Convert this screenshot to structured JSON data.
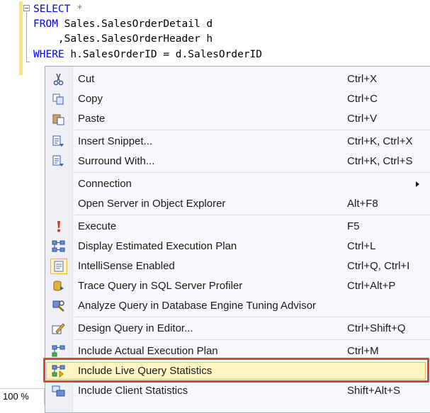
{
  "editor": {
    "lines": [
      {
        "kw": "SELECT",
        "rest": " *"
      },
      {
        "kw": "FROM",
        "rest": " Sales.SalesOrderDetail d"
      },
      {
        "kw": "",
        "rest": "    ,Sales.SalesOrderHeader h"
      },
      {
        "kw": "WHERE",
        "rest": " h.SalesOrderID = d.SalesOrderID"
      }
    ]
  },
  "status": {
    "zoom": "100 %"
  },
  "menu": {
    "items": [
      {
        "label": "Cut",
        "shortcut": "Ctrl+X",
        "icon": "scissors-icon"
      },
      {
        "label": "Copy",
        "shortcut": "Ctrl+C",
        "icon": "copy-icon"
      },
      {
        "label": "Paste",
        "shortcut": "Ctrl+V",
        "icon": "paste-icon"
      },
      {
        "label": "Insert Snippet...",
        "shortcut": "Ctrl+K, Ctrl+X",
        "icon": "snippet-icon"
      },
      {
        "label": "Surround With...",
        "shortcut": "Ctrl+K, Ctrl+S",
        "icon": "surround-icon"
      },
      {
        "label": "Connection",
        "shortcut": "",
        "icon": "",
        "submenu": true
      },
      {
        "label": "Open Server in Object Explorer",
        "shortcut": "Alt+F8",
        "icon": ""
      },
      {
        "label": "Execute",
        "shortcut": "F5",
        "icon": "execute-icon"
      },
      {
        "label": "Display Estimated Execution Plan",
        "shortcut": "Ctrl+L",
        "icon": "estimated-plan-icon"
      },
      {
        "label": "IntelliSense Enabled",
        "shortcut": "Ctrl+Q, Ctrl+I",
        "icon": "intellisense-icon"
      },
      {
        "label": "Trace Query in SQL Server Profiler",
        "shortcut": "Ctrl+Alt+P",
        "icon": "profiler-icon"
      },
      {
        "label": "Analyze Query in Database Engine Tuning Advisor",
        "shortcut": "",
        "icon": "tuning-advisor-icon"
      },
      {
        "label": "Design Query in Editor...",
        "shortcut": "Ctrl+Shift+Q",
        "icon": "design-query-icon"
      },
      {
        "label": "Include Actual Execution Plan",
        "shortcut": "Ctrl+M",
        "icon": "actual-plan-icon"
      },
      {
        "label": "Include Live Query Statistics",
        "shortcut": "",
        "icon": "live-statistics-icon",
        "highlighted": true
      },
      {
        "label": "Include Client Statistics",
        "shortcut": "Shift+Alt+S",
        "icon": "client-statistics-icon"
      }
    ]
  },
  "colors": {
    "keyword": "#0000ff",
    "highlight_fill": "#fdf4bf",
    "highlight_border": "#e5c365",
    "annotation_red": "#d9443b"
  }
}
